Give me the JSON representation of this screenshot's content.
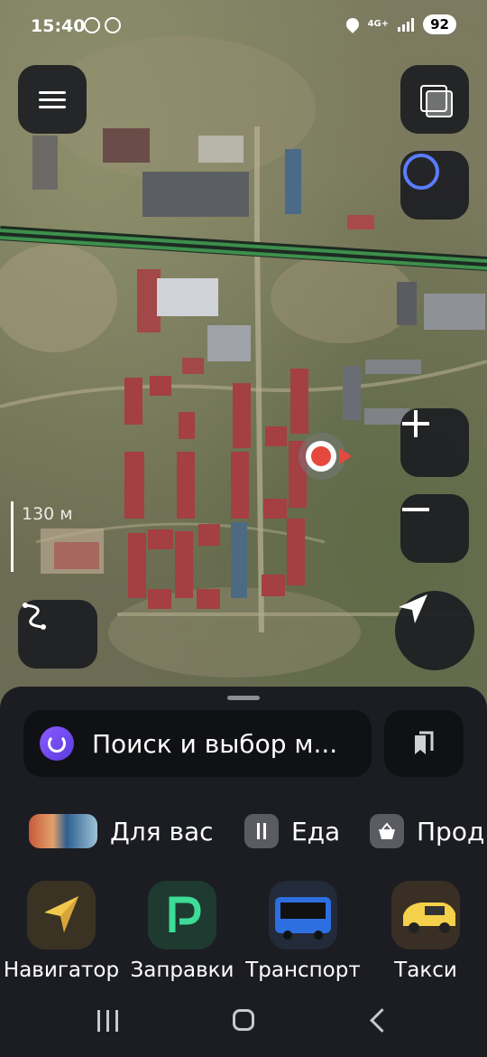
{
  "status_bar": {
    "time": "15:40",
    "network": "4G+",
    "battery": "92"
  },
  "map": {
    "scale_label": "130 м",
    "colors": {
      "road_green": "#3e8f4d",
      "location_red": "#e5493d"
    }
  },
  "search": {
    "text": "Поиск и выбор м..."
  },
  "chips": [
    {
      "label": "Для вас",
      "icon": "for-you-icon"
    },
    {
      "label": "Еда",
      "icon": "cutlery-icon"
    },
    {
      "label": "Прод",
      "icon": "basket-icon"
    }
  ],
  "tiles": [
    {
      "label": "Навигатор",
      "icon": "navigator-arrow-icon"
    },
    {
      "label": "Заправки",
      "icon": "fuel-p-icon"
    },
    {
      "label": "Транспорт",
      "icon": "bus-icon"
    },
    {
      "label": "Такси",
      "icon": "taxi-car-icon"
    }
  ]
}
